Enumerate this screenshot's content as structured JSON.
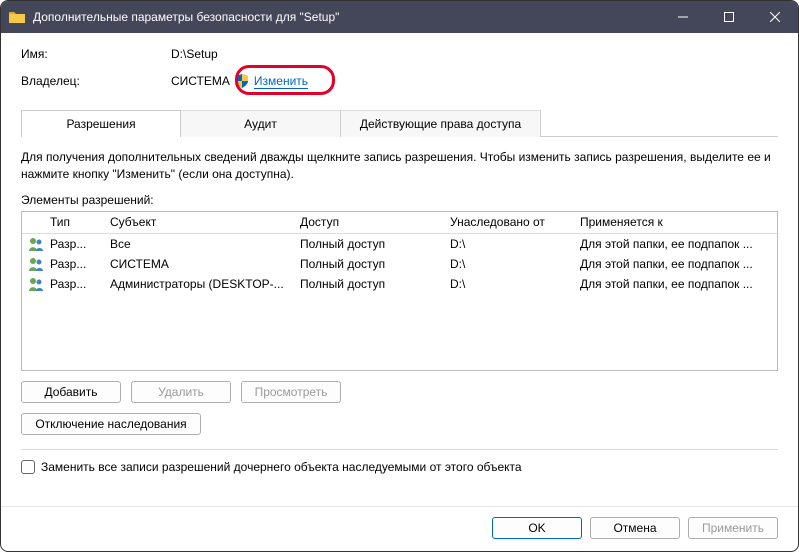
{
  "window": {
    "title": "Дополнительные параметры безопасности для \"Setup\""
  },
  "name": {
    "label": "Имя:",
    "value": "D:\\Setup"
  },
  "owner": {
    "label": "Владелец:",
    "value": "СИСТЕМА",
    "change_link": "Изменить"
  },
  "tabs": {
    "permissions": "Разрешения",
    "audit": "Аудит",
    "effective": "Действующие права доступа"
  },
  "help_text": "Для получения дополнительных сведений дважды щелкните запись разрешения. Чтобы изменить запись разрешения, выделите ее и нажмите кнопку \"Изменить\" (если она доступна).",
  "perm_elements_label": "Элементы разрешений:",
  "grid": {
    "headers": {
      "type": "Тип",
      "subject": "Субъект",
      "access": "Доступ",
      "inherited": "Унаследовано от",
      "applies": "Применяется к"
    },
    "rows": [
      {
        "type": "Разр...",
        "subject": "Все",
        "access": "Полный доступ",
        "inherited": "D:\\",
        "applies": "Для этой папки, ее подпапок ..."
      },
      {
        "type": "Разр...",
        "subject": "СИСТЕМА",
        "access": "Полный доступ",
        "inherited": "D:\\",
        "applies": "Для этой папки, ее подпапок ..."
      },
      {
        "type": "Разр...",
        "subject": "Администраторы (DESKTOP-...",
        "access": "Полный доступ",
        "inherited": "D:\\",
        "applies": "Для этой папки, ее подпапок ..."
      }
    ]
  },
  "buttons": {
    "add": "Добавить",
    "remove": "Удалить",
    "view": "Просмотреть",
    "disable_inherit": "Отключение наследования"
  },
  "replace_checkbox": "Заменить все записи разрешений дочернего объекта наследуемыми от этого объекта",
  "footer": {
    "ok": "OK",
    "cancel": "Отмена",
    "apply": "Применить"
  }
}
